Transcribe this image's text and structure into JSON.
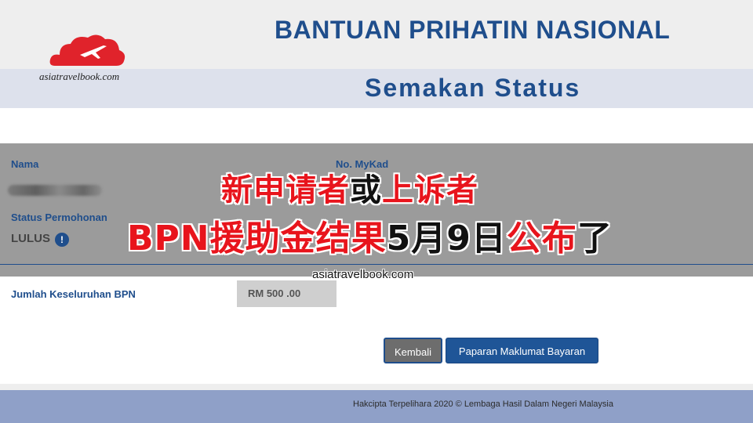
{
  "header": {
    "title": "BANTUAN PRIHATIN NASIONAL",
    "subtitle": "Semakan Status",
    "logo_text": "asiatravelbook.com"
  },
  "details": {
    "nama_label": "Nama",
    "mykad_label": "No. MyKad",
    "status_label": "Status Permohonan",
    "status_value": "LULUS",
    "info_glyph": "!",
    "jumlah_label": "Jumlah Keseluruhan BPN",
    "jumlah_value": "RM 500 .00"
  },
  "overlay": {
    "line1_a": "新申请者",
    "line1_b": "或",
    "line1_c": "上诉者",
    "line2_a": "BPN援助金结果",
    "line2_b": "5月9日",
    "line2_c": "公布",
    "line2_d": "了",
    "watermark": "asiatravelbook.com"
  },
  "buttons": {
    "back_label": "Kembali",
    "payment_label": "Paparan Maklumat Bayaran"
  },
  "footer": {
    "copyright": "Hakcipta Terpelihara 2020 © Lembaga Hasil Dalam Negeri Malaysia"
  },
  "colors": {
    "brand_blue": "#1f4e8c",
    "overlay_red": "#e8141c",
    "footer_bg": "#8fa0c8"
  },
  "icons": {
    "logo": "cloud-plane-icon",
    "status_info": "info-icon"
  }
}
